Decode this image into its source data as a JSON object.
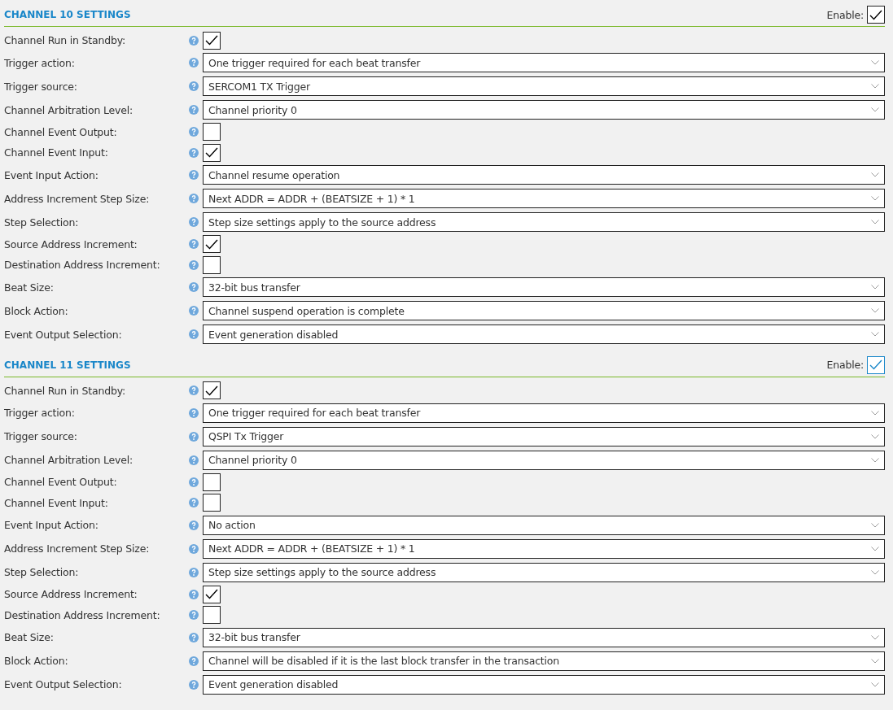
{
  "sections": [
    {
      "title": "CHANNEL 10 SETTINGS",
      "enable": {
        "label": "Enable:",
        "checked": true,
        "focused": false
      },
      "fields": [
        {
          "label": "Channel Run in Standby:",
          "kind": "checkbox",
          "checked": true
        },
        {
          "label": "Trigger action:",
          "kind": "select",
          "value": "One trigger required for each beat transfer"
        },
        {
          "label": "Trigger source:",
          "kind": "select",
          "value": "SERCOM1 TX Trigger"
        },
        {
          "label": "Channel Arbitration Level:",
          "kind": "select",
          "value": "Channel priority 0"
        },
        {
          "label": "Channel Event Output:",
          "kind": "checkbox",
          "checked": false
        },
        {
          "label": "Channel Event Input:",
          "kind": "checkbox",
          "checked": true
        },
        {
          "label": "Event Input Action:",
          "kind": "select",
          "value": "Channel resume operation"
        },
        {
          "label": "Address Increment Step Size:",
          "kind": "select",
          "value": "Next ADDR = ADDR + (BEATSIZE + 1) * 1"
        },
        {
          "label": "Step Selection:",
          "kind": "select",
          "value": "Step size settings apply to the source address"
        },
        {
          "label": "Source Address Increment:",
          "kind": "checkbox",
          "checked": true
        },
        {
          "label": "Destination Address Increment:",
          "kind": "checkbox",
          "checked": false
        },
        {
          "label": "Beat Size:",
          "kind": "select",
          "value": "32-bit bus transfer"
        },
        {
          "label": "Block Action:",
          "kind": "select",
          "value": "Channel suspend operation is complete"
        },
        {
          "label": "Event Output Selection:",
          "kind": "select",
          "value": "Event generation disabled"
        }
      ]
    },
    {
      "title": "CHANNEL 11 SETTINGS",
      "enable": {
        "label": "Enable:",
        "checked": true,
        "focused": true
      },
      "fields": [
        {
          "label": "Channel Run in Standby:",
          "kind": "checkbox",
          "checked": true
        },
        {
          "label": "Trigger action:",
          "kind": "select",
          "value": "One trigger required for each beat transfer"
        },
        {
          "label": "Trigger source:",
          "kind": "select",
          "value": "QSPI Tx Trigger"
        },
        {
          "label": "Channel Arbitration Level:",
          "kind": "select",
          "value": "Channel priority 0"
        },
        {
          "label": "Channel Event Output:",
          "kind": "checkbox",
          "checked": false
        },
        {
          "label": "Channel Event Input:",
          "kind": "checkbox",
          "checked": false
        },
        {
          "label": "Event Input Action:",
          "kind": "select",
          "value": "No action"
        },
        {
          "label": "Address Increment Step Size:",
          "kind": "select",
          "value": "Next ADDR = ADDR + (BEATSIZE + 1) * 1"
        },
        {
          "label": "Step Selection:",
          "kind": "select",
          "value": "Step size settings apply to the source address"
        },
        {
          "label": "Source Address Increment:",
          "kind": "checkbox",
          "checked": true
        },
        {
          "label": "Destination Address Increment:",
          "kind": "checkbox",
          "checked": false
        },
        {
          "label": "Beat Size:",
          "kind": "select",
          "value": "32-bit bus transfer"
        },
        {
          "label": "Block Action:",
          "kind": "select",
          "value": "Channel will be disabled if it is the last block transfer in the transaction"
        },
        {
          "label": "Event Output Selection:",
          "kind": "select",
          "value": "Event generation disabled"
        }
      ]
    }
  ]
}
